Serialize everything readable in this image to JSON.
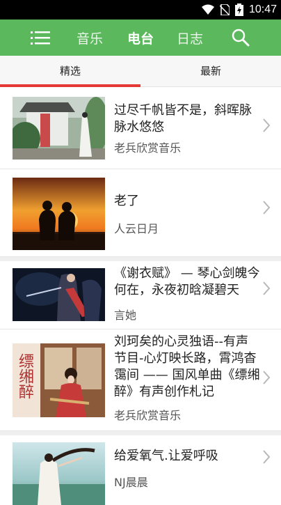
{
  "status": {
    "time": "10:47"
  },
  "nav": {
    "music": "音乐",
    "radio": "电台",
    "journal": "日志"
  },
  "tabs": {
    "featured": "精选",
    "latest": "最新"
  },
  "items": [
    {
      "title": "过尽千帆皆不是，斜晖脉脉水悠悠",
      "author": "老兵欣赏音乐"
    },
    {
      "title": "老了",
      "author": "人云日月"
    },
    {
      "title": "《谢衣赋》 — 琴心剑魄今何在，永夜初晗凝碧天",
      "author": "言她"
    },
    {
      "title": "刘珂矣的心灵独语--有声节目-心灯映长路，霄鸿杳霭间 —— 国风单曲《缥缃醉》有声创作札记",
      "author": "老兵欣赏音乐"
    },
    {
      "title": "给爱氧气.让爱呼吸",
      "author": "NJ晨晨"
    }
  ],
  "thumb_text": {
    "item3": "缥缃醉"
  },
  "colors": {
    "appbar": "#5cb85c",
    "indicator": "#e53935"
  }
}
